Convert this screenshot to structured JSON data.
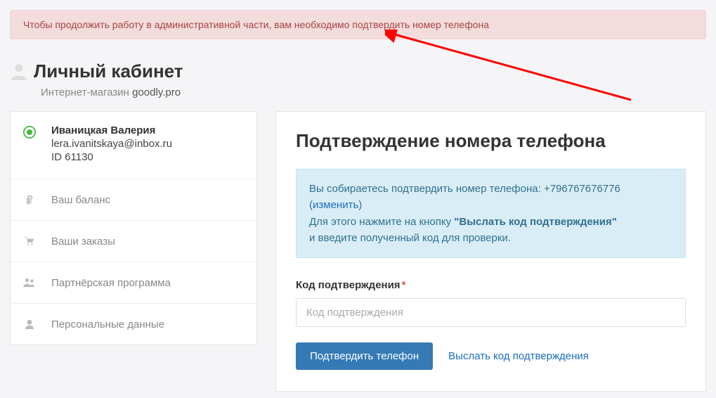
{
  "alert": {
    "text": "Чтобы продолжить работу в административной части, вам необходимо подтвердить номер телефона"
  },
  "header": {
    "title": "Личный кабинет",
    "subtitle_prefix": "Интернет-магазин ",
    "shop_name": "goodly.pro"
  },
  "sidebar": {
    "user": {
      "name": "Иваницкая Валерия",
      "email": "lera.ivanitskaya@inbox.ru",
      "id": "ID 61130"
    },
    "items": [
      {
        "icon": "ruble-icon",
        "label": "Ваш баланс"
      },
      {
        "icon": "cart-icon",
        "label": "Ваши заказы"
      },
      {
        "icon": "users-icon",
        "label": "Партнёрская программа"
      },
      {
        "icon": "user-icon",
        "label": "Персональные данные"
      }
    ]
  },
  "main": {
    "title": "Подтверждение номера телефона",
    "info": {
      "line1_prefix": "Вы собираетесь подтвердить номер телефона: ",
      "phone": "+796767676776",
      "change_label": "изменить",
      "line2_prefix": "Для этого нажмите на кнопку ",
      "button_ref": "\"Выслать код подтверждения\"",
      "line3": "и введите полученный код для проверки."
    },
    "form": {
      "code_label": "Код подтверждения",
      "code_placeholder": "Код подтверждения",
      "confirm_button": "Подтвердить телефон",
      "resend_link": "Выслать код подтверждения"
    }
  },
  "colors": {
    "alert_bg": "#f2dcdc",
    "alert_text": "#a94442",
    "info_bg": "#d9edf7",
    "info_text": "#31708f",
    "primary_btn": "#337ab7",
    "link": "#1b6ec2",
    "user_status": "#4bb543",
    "annotation_arrow": "#ff0000"
  }
}
